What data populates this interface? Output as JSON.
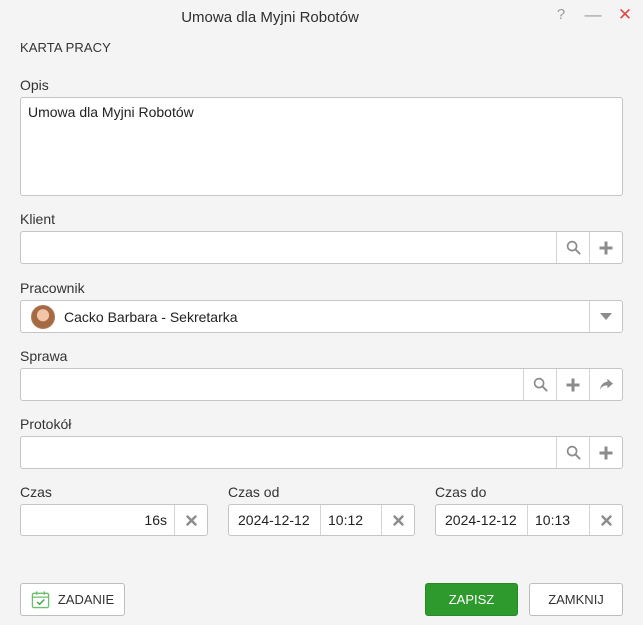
{
  "window": {
    "title": "Umowa dla Myjni Robotów",
    "help_glyph": "?",
    "min_glyph": "—",
    "close_glyph": "✕"
  },
  "section_title": "KARTA PRACY",
  "opis": {
    "label": "Opis",
    "value": "Umowa dla Myjni Robotów"
  },
  "klient": {
    "label": "Klient",
    "value": ""
  },
  "pracownik": {
    "label": "Pracownik",
    "value": "Cacko Barbara - Sekretarka"
  },
  "sprawa": {
    "label": "Sprawa",
    "value": ""
  },
  "protokol": {
    "label": "Protokół",
    "value": ""
  },
  "czas": {
    "label": "Czas",
    "value": "16s"
  },
  "czas_od": {
    "label": "Czas od",
    "date": "2024-12-12",
    "time": "10:12"
  },
  "czas_do": {
    "label": "Czas do",
    "date": "2024-12-12",
    "time": "10:13"
  },
  "buttons": {
    "zadanie": "ZADANIE",
    "zapisz": "ZAPISZ",
    "zamknij": "ZAMKNIJ"
  },
  "colors": {
    "primary_green": "#2e9a2e",
    "close_red": "#e04848",
    "icon_gray": "#8c8c8c"
  },
  "icons": {
    "search": "search-icon",
    "add": "plus-icon",
    "forward": "share-arrow-icon",
    "dropdown": "chevron-down-icon",
    "clear": "close-icon",
    "task": "calendar-check-icon"
  }
}
